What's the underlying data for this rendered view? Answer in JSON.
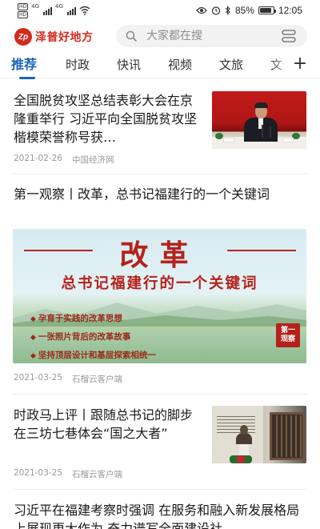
{
  "status_bar": {
    "hd1": "HD",
    "hd2": "HD",
    "net1": "4G",
    "net2": "4G",
    "battery": "85%",
    "battery_level": 0.85,
    "time": "12:05",
    "icons": [
      "eye-icon",
      "alarm-icon",
      "bluetooth-icon",
      "wifi-icon",
      "signal-icon",
      "battery-icon"
    ]
  },
  "header": {
    "logo_mark": "Zp",
    "logo_text": "泽普好地方",
    "search_placeholder": "大家都在搜",
    "brand_color": "#d52a1e"
  },
  "tabs": {
    "items": [
      "推荐",
      "时政",
      "快讯",
      "视频",
      "文旅",
      "文"
    ],
    "active_index": 0,
    "active_color": "#1b63b8",
    "add_label": "+"
  },
  "news": [
    {
      "title": "全国脱贫攻坚总结表彰大会在京隆重举行 习近平向全国脱贫攻坚楷模荣誉称号获…",
      "date": "2021-02-26",
      "source": "中国经济网"
    },
    {
      "title": "第一观察丨改革，总书记福建行的一个关键词",
      "banner": {
        "title": "改革",
        "subtitle": "总书记福建行的一个关键词",
        "bullets": [
          "孕育于实践的改革思想",
          "一张照片背后的改革故事",
          "坚持顶层设计和基层探索相统一"
        ],
        "stamp_line1": "第一",
        "stamp_line2": "观察"
      },
      "date": "2021-03-25",
      "source": "石榴云客户端"
    },
    {
      "title": "时政马上评丨跟随总书记的脚步 在三坊七巷体会“国之大者”",
      "date": "2021-03-25",
      "source": "石榴云客户端"
    },
    {
      "title": "习近平在福建考察时强调 在服务和融入新发展格局上展现更大作为 奋力谱写全面建设社"
    }
  ]
}
